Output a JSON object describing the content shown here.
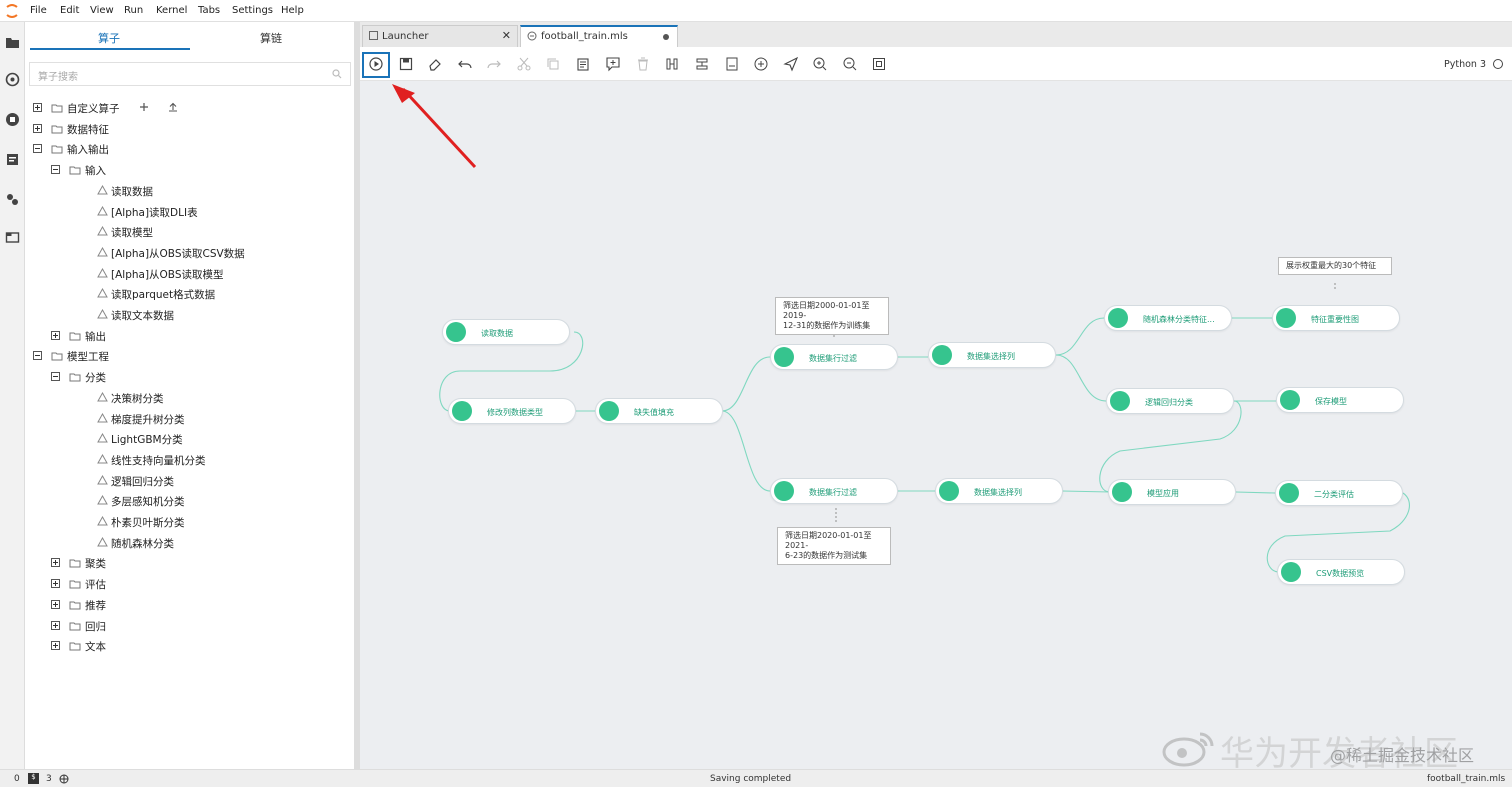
{
  "menubar": {
    "items": [
      "File",
      "Edit",
      "View",
      "Run",
      "Kernel",
      "Tabs",
      "Settings",
      "Help"
    ]
  },
  "left_panel": {
    "tabs": [
      "算子",
      "算链"
    ],
    "search_placeholder": "算子搜索",
    "tree": [
      {
        "label": "自定义算子",
        "toggle": "plus",
        "type": "folder"
      },
      {
        "label": "数据特征",
        "toggle": "plus",
        "type": "folder"
      },
      {
        "label": "输入输出",
        "toggle": "minus",
        "type": "folder"
      },
      {
        "label": "输入",
        "toggle": "minus",
        "type": "folder"
      },
      {
        "label": "读取数据",
        "type": "op"
      },
      {
        "label": "[Alpha]读取DLI表",
        "type": "op"
      },
      {
        "label": "读取模型",
        "type": "op"
      },
      {
        "label": "[Alpha]从OBS读取CSV数据",
        "type": "op"
      },
      {
        "label": "[Alpha]从OBS读取模型",
        "type": "op"
      },
      {
        "label": "读取parquet格式数据",
        "type": "op"
      },
      {
        "label": "读取文本数据",
        "type": "op"
      },
      {
        "label": "输出",
        "toggle": "plus",
        "type": "folder"
      },
      {
        "label": "模型工程",
        "toggle": "minus",
        "type": "folder"
      },
      {
        "label": "分类",
        "toggle": "minus",
        "type": "folder"
      },
      {
        "label": "决策树分类",
        "type": "op"
      },
      {
        "label": "梯度提升树分类",
        "type": "op"
      },
      {
        "label": "LightGBM分类",
        "type": "op"
      },
      {
        "label": "线性支持向量机分类",
        "type": "op"
      },
      {
        "label": "逻辑回归分类",
        "type": "op"
      },
      {
        "label": "多层感知机分类",
        "type": "op"
      },
      {
        "label": "朴素贝叶斯分类",
        "type": "op"
      },
      {
        "label": "随机森林分类",
        "type": "op"
      },
      {
        "label": "聚类",
        "toggle": "plus",
        "type": "folder"
      },
      {
        "label": "评估",
        "toggle": "plus",
        "type": "folder"
      },
      {
        "label": "推荐",
        "toggle": "plus",
        "type": "folder"
      },
      {
        "label": "回归",
        "toggle": "plus",
        "type": "folder"
      },
      {
        "label": "文本",
        "toggle": "plus",
        "type": "folder"
      }
    ]
  },
  "tabs": [
    {
      "label": "Launcher"
    },
    {
      "label": "football_train.mls"
    }
  ],
  "kernel": {
    "name": "Python 3"
  },
  "canvas": {
    "nodes": [
      {
        "id": "n1",
        "label": "读取数据"
      },
      {
        "id": "n2",
        "label": "修改列数据类型"
      },
      {
        "id": "n3",
        "label": "缺失值填充"
      },
      {
        "id": "n4",
        "label": "数据集行过滤"
      },
      {
        "id": "n5",
        "label": "数据集选择列"
      },
      {
        "id": "n6",
        "label": "随机森林分类特征..."
      },
      {
        "id": "n7",
        "label": "特征重要性图"
      },
      {
        "id": "n8",
        "label": "逻辑回归分类"
      },
      {
        "id": "n9",
        "label": "保存模型"
      },
      {
        "id": "n10",
        "label": "数据集行过滤"
      },
      {
        "id": "n11",
        "label": "数据集选择列"
      },
      {
        "id": "n12",
        "label": "模型应用"
      },
      {
        "id": "n13",
        "label": "二分类评估"
      },
      {
        "id": "n14",
        "label": "CSV数据预览"
      }
    ],
    "notes": [
      {
        "lines": [
          "筛选日期2000-01-01至2019-",
          "12-31的数据作为训练集"
        ]
      },
      {
        "lines": [
          "展示权重最大的30个特征"
        ]
      },
      {
        "lines": [
          "筛选日期2020-01-01至2021-",
          "6-23的数据作为测试集"
        ]
      }
    ],
    "edge_color": "#7fd8c0",
    "node_icon_color": "#36c48e"
  },
  "status": {
    "left1": "0",
    "left2": "3",
    "center": "Saving completed",
    "right": "football_train.mls"
  },
  "watermark": {
    "line1": "华为开发者社区",
    "line2": "@稀土掘金技术社区"
  },
  "colors": {
    "accent": "#1a73b8",
    "highlight_box": "#1a73b8",
    "arrow": "#e02020"
  }
}
